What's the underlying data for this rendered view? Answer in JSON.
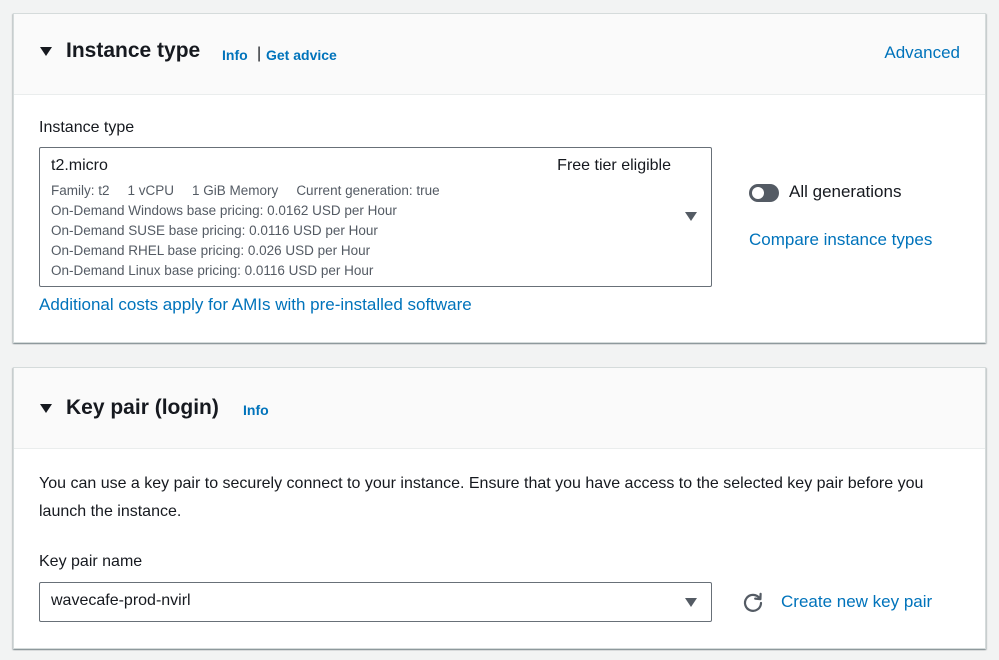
{
  "instance_type_section": {
    "title": "Instance type",
    "info_label": "Info",
    "separator": "|",
    "advice_label": "Get advice",
    "advanced_label": "Advanced",
    "field_label": "Instance type",
    "selected": {
      "name": "t2.micro",
      "tag": "Free tier eligible",
      "family": "Family: t2",
      "vcpu": "1 vCPU",
      "memory": "1 GiB Memory",
      "generation": "Current generation: true",
      "pricing": [
        "On-Demand Windows base pricing: 0.0162 USD per Hour",
        "On-Demand SUSE base pricing: 0.0116 USD per Hour",
        "On-Demand RHEL base pricing: 0.026 USD per Hour",
        "On-Demand Linux base pricing: 0.0116 USD per Hour"
      ]
    },
    "additional_costs_link": "Additional costs apply for AMIs with pre-installed software",
    "all_generations_label": "All generations",
    "all_generations_enabled": false,
    "compare_link": "Compare instance types"
  },
  "key_pair_section": {
    "title": "Key pair (login)",
    "info_label": "Info",
    "description": "You can use a key pair to securely connect to your instance. Ensure that you have access to the selected key pair before you launch the instance.",
    "field_label": "Key pair name",
    "selected_value": "wavecafe-prod-nvirl",
    "create_link": "Create new key pair"
  },
  "colors": {
    "link": "#0073bb",
    "text": "#16191f",
    "secondary_text": "#545b64",
    "page_bg": "#f2f3f3",
    "header_bg": "#fafafa"
  },
  "icons": {
    "section_caret": "caret-down-icon",
    "dropdown_caret": "caret-down-icon",
    "refresh": "refresh-icon"
  }
}
